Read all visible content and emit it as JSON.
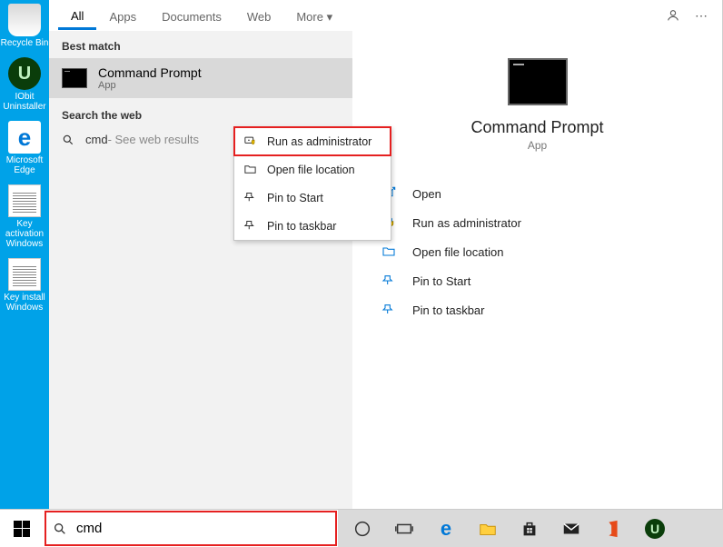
{
  "desktop": {
    "items": [
      {
        "label": "Recycle Bin"
      },
      {
        "label": "IObit Uninstaller"
      },
      {
        "label": "Microsoft Edge"
      },
      {
        "label": "Key activation Windows"
      },
      {
        "label": "Key install Windows"
      }
    ]
  },
  "tabs": {
    "items": [
      "All",
      "Apps",
      "Documents",
      "Web",
      "More"
    ],
    "active_index": 0
  },
  "left": {
    "best_match_label": "Best match",
    "result": {
      "name": "Command Prompt",
      "type": "App"
    },
    "search_web_label": "Search the web",
    "web_query": "cmd",
    "web_suffix": " - See web results"
  },
  "context_menu": {
    "items": [
      {
        "label": "Run as administrator",
        "icon": "shield-run-icon",
        "highlight": true
      },
      {
        "label": "Open file location",
        "icon": "folder-icon"
      },
      {
        "label": "Pin to Start",
        "icon": "pin-icon"
      },
      {
        "label": "Pin to taskbar",
        "icon": "pin-taskbar-icon"
      }
    ]
  },
  "detail": {
    "title": "Command Prompt",
    "subtitle": "App",
    "actions": [
      {
        "label": "Open",
        "icon": "open-icon"
      },
      {
        "label": "Run as administrator",
        "icon": "shield-run-icon"
      },
      {
        "label": "Open file location",
        "icon": "folder-icon"
      },
      {
        "label": "Pin to Start",
        "icon": "pin-icon"
      },
      {
        "label": "Pin to taskbar",
        "icon": "pin-taskbar-icon"
      }
    ]
  },
  "taskbar": {
    "search_value": "cmd",
    "buttons": [
      "cortana-icon",
      "taskview-icon",
      "edge-icon",
      "explorer-icon",
      "store-icon",
      "mail-icon",
      "office-icon",
      "iobit-icon"
    ]
  },
  "colors": {
    "accent": "#0078d7",
    "highlight": "#e52020"
  }
}
